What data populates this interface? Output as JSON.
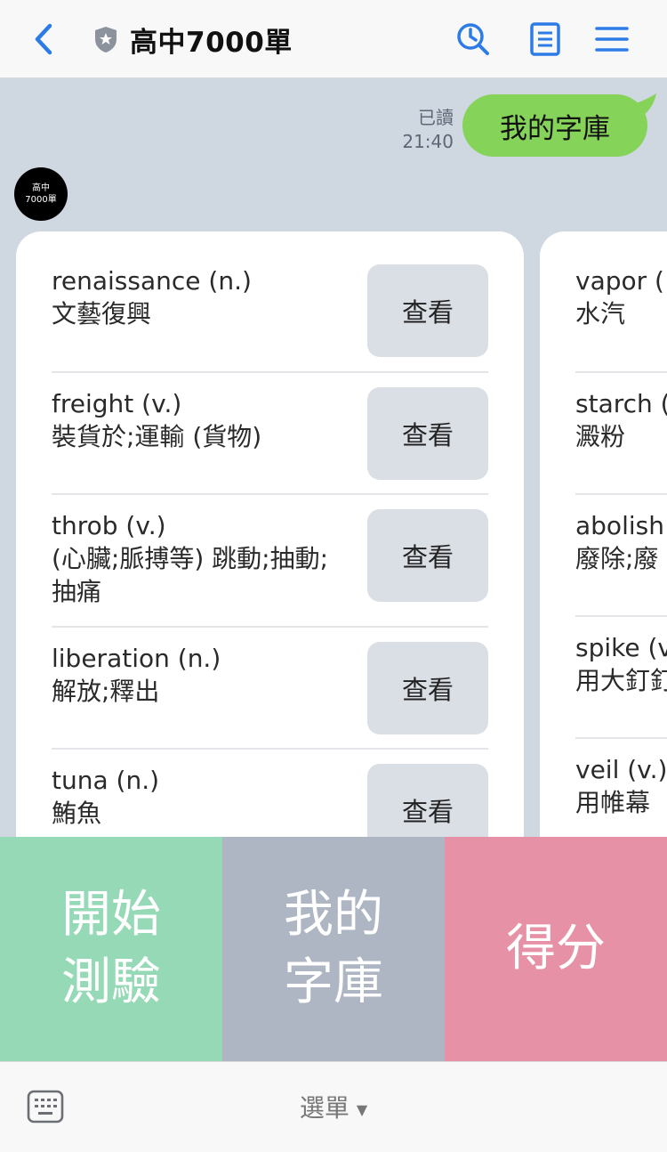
{
  "header": {
    "title": "高中7000單"
  },
  "chat": {
    "read_status": "已讀",
    "time": "21:40",
    "my_message": "我的字庫",
    "avatar_text_1": "高中",
    "avatar_text_2": "7000單"
  },
  "card_1": {
    "words": [
      {
        "en": "renaissance (n.)",
        "zh": "文藝復興",
        "button": "查看"
      },
      {
        "en": "freight (v.)",
        "zh": "裝貨於;運輸 (貨物)",
        "button": "查看"
      },
      {
        "en": "throb (v.)",
        "zh": "(心臟;脈搏等) 跳動;抽動;抽痛",
        "button": "查看"
      },
      {
        "en": "liberation (n.)",
        "zh": "解放;釋出",
        "button": "查看"
      },
      {
        "en": "tuna (n.)",
        "zh": "鮪魚",
        "button": "查看"
      }
    ]
  },
  "card_2": {
    "words": [
      {
        "en": "vapor (",
        "zh": "水汽"
      },
      {
        "en": "starch (",
        "zh": "澱粉"
      },
      {
        "en": "abolish",
        "zh": "廢除;廢"
      },
      {
        "en": "spike (v",
        "zh": "用大釘釘"
      },
      {
        "en": "veil (v.)",
        "zh": "用帷幕"
      }
    ]
  },
  "richmenu": {
    "start_quiz": "開始測驗",
    "my_library": "我的字庫",
    "score": "得分"
  },
  "bottombar": {
    "menu_label": "選單"
  }
}
